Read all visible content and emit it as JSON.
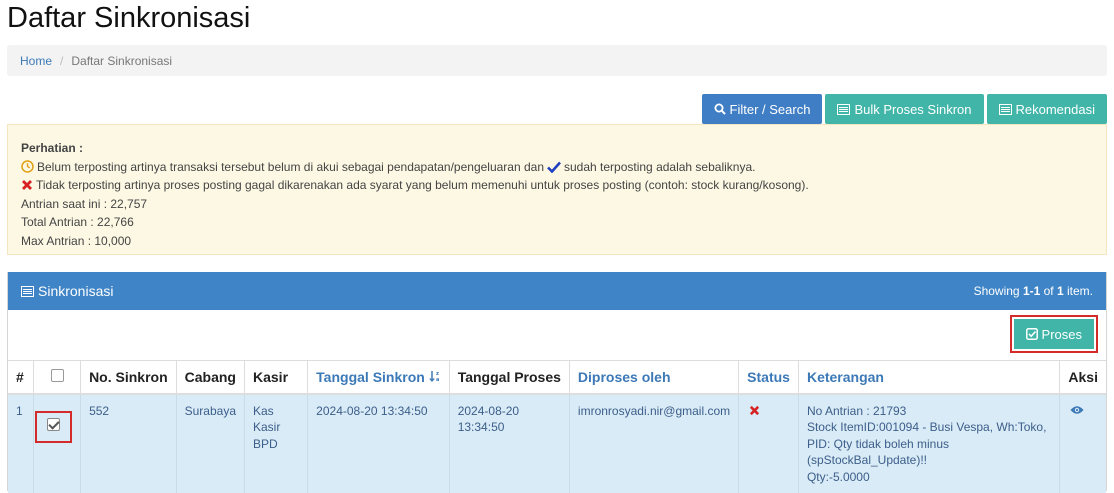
{
  "page": {
    "title": "Daftar Sinkronisasi"
  },
  "breadcrumb": {
    "home": "Home",
    "current": "Daftar Sinkronisasi"
  },
  "toolbar": {
    "filter_label": "Filter / Search",
    "bulk_label": "Bulk Proses Sinkron",
    "rekomendasi_label": "Rekomendasi"
  },
  "notice": {
    "title": "Perhatian :",
    "line1_a": "Belum terposting artinya transaksi tersebut belum di akui sebagai pendapatan/pengeluaran dan",
    "line1_b": "sudah terposting adalah sebaliknya.",
    "line2": "Tidak terposting artinya proses posting gagal dikarenakan ada syarat yang belum memenuhi untuk proses posting (contoh: stock kurang/kosong).",
    "queue_now": "Antrian saat ini : 22,757",
    "queue_total": "Total Antrian : 22,766",
    "queue_max": "Max Antrian : 10,000"
  },
  "panel": {
    "title": "Sinkronisasi",
    "showing_prefix": "Showing ",
    "showing_range": "1-1",
    "showing_of": " of ",
    "showing_total": "1",
    "showing_suffix": " item.",
    "proses_label": "Proses"
  },
  "table": {
    "headers": {
      "num": "#",
      "no_sinkron": "No. Sinkron",
      "cabang": "Cabang",
      "kasir": "Kasir",
      "tanggal_sinkron": "Tanggal Sinkron",
      "tanggal_proses": "Tanggal Proses",
      "diproses_oleh": "Diproses oleh",
      "status": "Status",
      "keterangan": "Keterangan",
      "aksi": "Aksi"
    },
    "rows": [
      {
        "num": "1",
        "checked": true,
        "no_sinkron": "552",
        "cabang": "Surabaya",
        "kasir": "Kas Kasir BPD",
        "tanggal_sinkron": "2024-08-20 13:34:50",
        "tanggal_proses": "2024-08-20 13:34:50",
        "diproses_oleh": "imronrosyadi.nir@gmail.com",
        "status_icon": "x-mark-icon",
        "ket_line1": "No Antrian : 21793",
        "ket_line2": "Stock ItemID:001094 - Busi Vespa, Wh:Toko, PID: Qty tidak boleh minus (spStockBal_Update)!!",
        "ket_line3": "Qty:-5.0000"
      }
    ]
  },
  "colors": {
    "primary": "#3f7ec4",
    "teal": "#40b5a8",
    "panel_heading": "#3e84c6",
    "row_bg": "#d9ebf6",
    "highlight_red": "#d32a2a",
    "alert_bg": "#fcf8e3"
  }
}
